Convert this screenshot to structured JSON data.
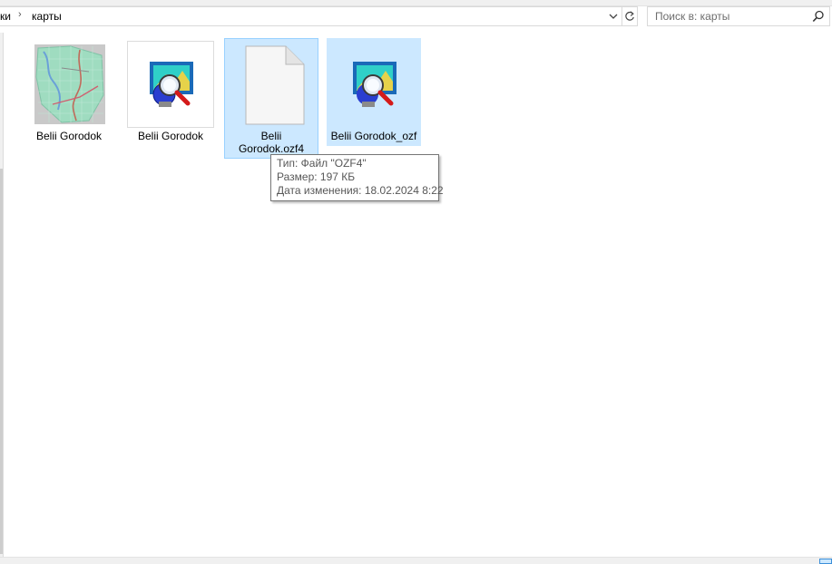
{
  "address_bar": {
    "breadcrumb_prev": "ки",
    "breadcrumb_sep": "›",
    "breadcrumb_current": "карты",
    "icons": {
      "dropdown": "chevron-down-icon",
      "refresh": "refresh-icon"
    }
  },
  "search": {
    "placeholder": "Поиск в: карты",
    "value": "",
    "icon": "search-icon"
  },
  "files": [
    {
      "label": "Belii Gorodok",
      "icon": "map-thumbnail-icon",
      "selected": false
    },
    {
      "label": "Belii Gorodok",
      "icon": "ozi-explorer-icon",
      "selected": false
    },
    {
      "label": "Belii Gorodok.ozf4",
      "icon": "blank-file-icon",
      "selected": true
    },
    {
      "label": "Belii Gorodok_ozf",
      "icon": "ozi-explorer-icon",
      "selected": true
    }
  ],
  "tooltip": {
    "type": "Тип: Файл \"OZF4\"",
    "size": "Размер: 197 КБ",
    "modified": "Дата изменения: 18.02.2024 8:22"
  },
  "colors": {
    "selection": "#cce8ff",
    "selection_border": "#99d1ff"
  }
}
